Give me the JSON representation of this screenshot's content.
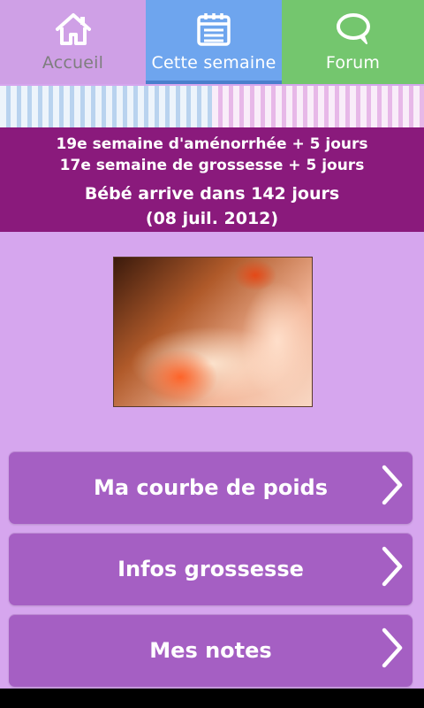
{
  "tabs": [
    {
      "label": "Accueil",
      "icon": "home-icon",
      "active": false
    },
    {
      "label": "Cette semaine",
      "icon": "calendar-icon",
      "active": true
    },
    {
      "label": "Forum",
      "icon": "chat-bubble-icon",
      "active": false
    }
  ],
  "banner": {
    "line1": "19e semaine d'aménorrhée + 5 jours",
    "line2": "17e semaine de grossesse + 5 jours",
    "line3": "Bébé arrive dans 142 jours",
    "line4": "(08 juil. 2012)"
  },
  "menu": [
    {
      "label": "Ma courbe de poids"
    },
    {
      "label": "Infos grossesse"
    },
    {
      "label": "Mes notes"
    }
  ],
  "colors": {
    "tab_home": "#cfa0e6",
    "tab_week": "#6ea5ee",
    "tab_forum": "#74c66e",
    "banner": "#8a1a7c",
    "page_bg": "#d6a6ee",
    "button": "#a55fc3"
  }
}
